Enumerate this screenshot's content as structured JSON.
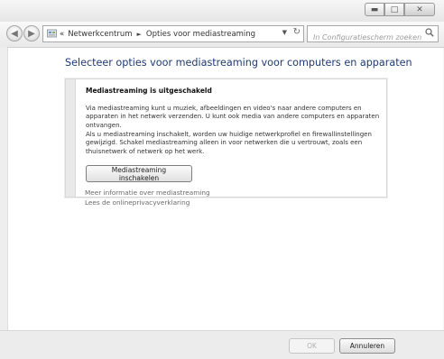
{
  "window": {
    "caption_buttons": [
      {
        "name": "minimize",
        "glyph": "▬"
      },
      {
        "name": "maximize",
        "glyph": "□"
      },
      {
        "name": "close",
        "glyph": "✕"
      }
    ]
  },
  "navbar": {
    "back_glyph": "◀",
    "forward_glyph": "▶",
    "address": {
      "overflow": "«",
      "crumbs": [
        "Netwerkcentrum",
        "Opties voor mediastreaming"
      ],
      "separator": "►",
      "dropdown_glyph": "▼",
      "refresh_glyph": "↻"
    },
    "search": {
      "placeholder": "In Configuratiescherm zoeken",
      "icon": "search-icon"
    }
  },
  "content": {
    "heading": "Selecteer opties voor mediastreaming voor computers en apparaten",
    "infobox": {
      "title": "Mediastreaming is uitgeschakeld",
      "paragraph1": "Via mediastreaming kunt u muziek, afbeeldingen en video's naar andere computers en apparaten in het netwerk verzenden. U kunt ook media van andere computers en apparaten ontvangen.",
      "paragraph2": "Als u mediastreaming inschakelt, worden uw huidige netwerkprofiel en firewallinstellingen gewijzigd. Schakel mediastreaming alleen in voor netwerken die u vertrouwt, zoals een thuisnetwerk of netwerk op het werk.",
      "button_label": "Mediastreaming inschakelen"
    },
    "links": [
      "Meer informatie over mediastreaming",
      "Lees de onlineprivacyverklaring"
    ]
  },
  "footer": {
    "ok_label": "OK",
    "cancel_label": "Annuleren"
  }
}
